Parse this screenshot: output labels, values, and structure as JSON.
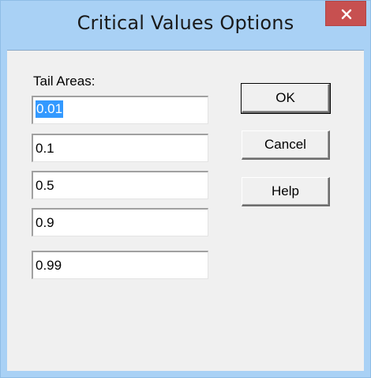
{
  "window": {
    "title": "Critical Values Options"
  },
  "form": {
    "tail_areas_label": "Tail Areas:",
    "fields": [
      "0.01",
      "0.1",
      "0.5",
      "0.9",
      "0.99"
    ]
  },
  "buttons": {
    "ok": "OK",
    "cancel": "Cancel",
    "help": "Help"
  },
  "colors": {
    "titlebar": "#a9d1f5",
    "close_button": "#c75050",
    "client_background": "#f0f0f0",
    "selection": "#3399ff"
  },
  "icons": {
    "close": "close-icon"
  }
}
